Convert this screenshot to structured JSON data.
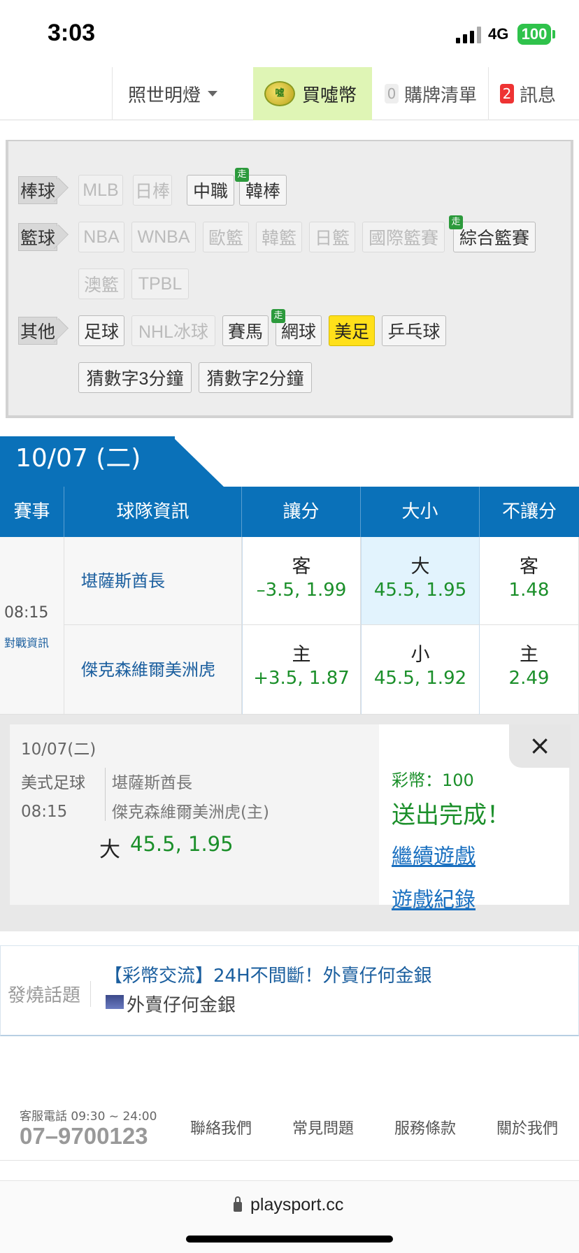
{
  "status": {
    "time": "3:03",
    "network": "4G",
    "battery": "100"
  },
  "topnav": {
    "user": "照世明燈",
    "buy": "買噓幣",
    "coin_glyph": "噓",
    "cart_count": "0",
    "cart": "購牌清單",
    "msg_count": "2",
    "msg": "訊息"
  },
  "categories": {
    "baseball": {
      "label": "棒球",
      "items": [
        "MLB",
        "日棒",
        "中職",
        "韓棒"
      ]
    },
    "basketball": {
      "label": "籃球",
      "items": [
        "NBA",
        "WNBA",
        "歐籃",
        "韓籃",
        "日籃",
        "國際籃賽",
        "綜合籃賽",
        "澳籃",
        "TPBL"
      ]
    },
    "other": {
      "label": "其他",
      "items": [
        "足球",
        "NHL冰球",
        "賽馬",
        "網球",
        "美足",
        "乒乓球",
        "猜數字3分鐘",
        "猜數字2分鐘"
      ]
    },
    "walk_badge": "走"
  },
  "date_tab": "10/07 (二)",
  "table": {
    "headers": [
      "賽事",
      "球隊資訊",
      "讓分",
      "大小",
      "不讓分"
    ],
    "time": "08:15",
    "matchup_link": "對戰資訊",
    "rows": [
      {
        "team": "堪薩斯酋長",
        "spread_label": "客",
        "spread": "–3.5, 1.99",
        "total_label": "大",
        "total": "45.5, 1.95",
        "ml_label": "客",
        "ml": "1.48"
      },
      {
        "team": "傑克森維爾美洲虎",
        "spread_label": "主",
        "spread": "+3.5, 1.87",
        "total_label": "小",
        "total": "45.5, 1.92",
        "ml_label": "主",
        "ml": "2.49"
      }
    ]
  },
  "ticket": {
    "date": "10/07(二)",
    "sport": "美式足球",
    "time": "08:15",
    "team1": "堪薩斯酋長",
    "team2": "傑克森維爾美洲虎(主)",
    "pick_label": "大",
    "pick_value": "45.5, 1.95",
    "coins": "彩幣：100",
    "success": "送出完成！",
    "continue": "繼續遊戲",
    "history": "遊戲紀錄",
    "close": "×"
  },
  "hot": {
    "label": "發燒話題",
    "title": "【彩幣交流】24H不間斷！外賣仔何金銀",
    "user": "外賣仔何金銀"
  },
  "footer": {
    "service_hours": "客服電話 09:30 ~ 24:00",
    "phone": "07–9700123",
    "links": [
      "聯絡我們",
      "常見問題",
      "服務條款",
      "關於我們"
    ]
  },
  "browser": {
    "url": "playsport.cc"
  }
}
